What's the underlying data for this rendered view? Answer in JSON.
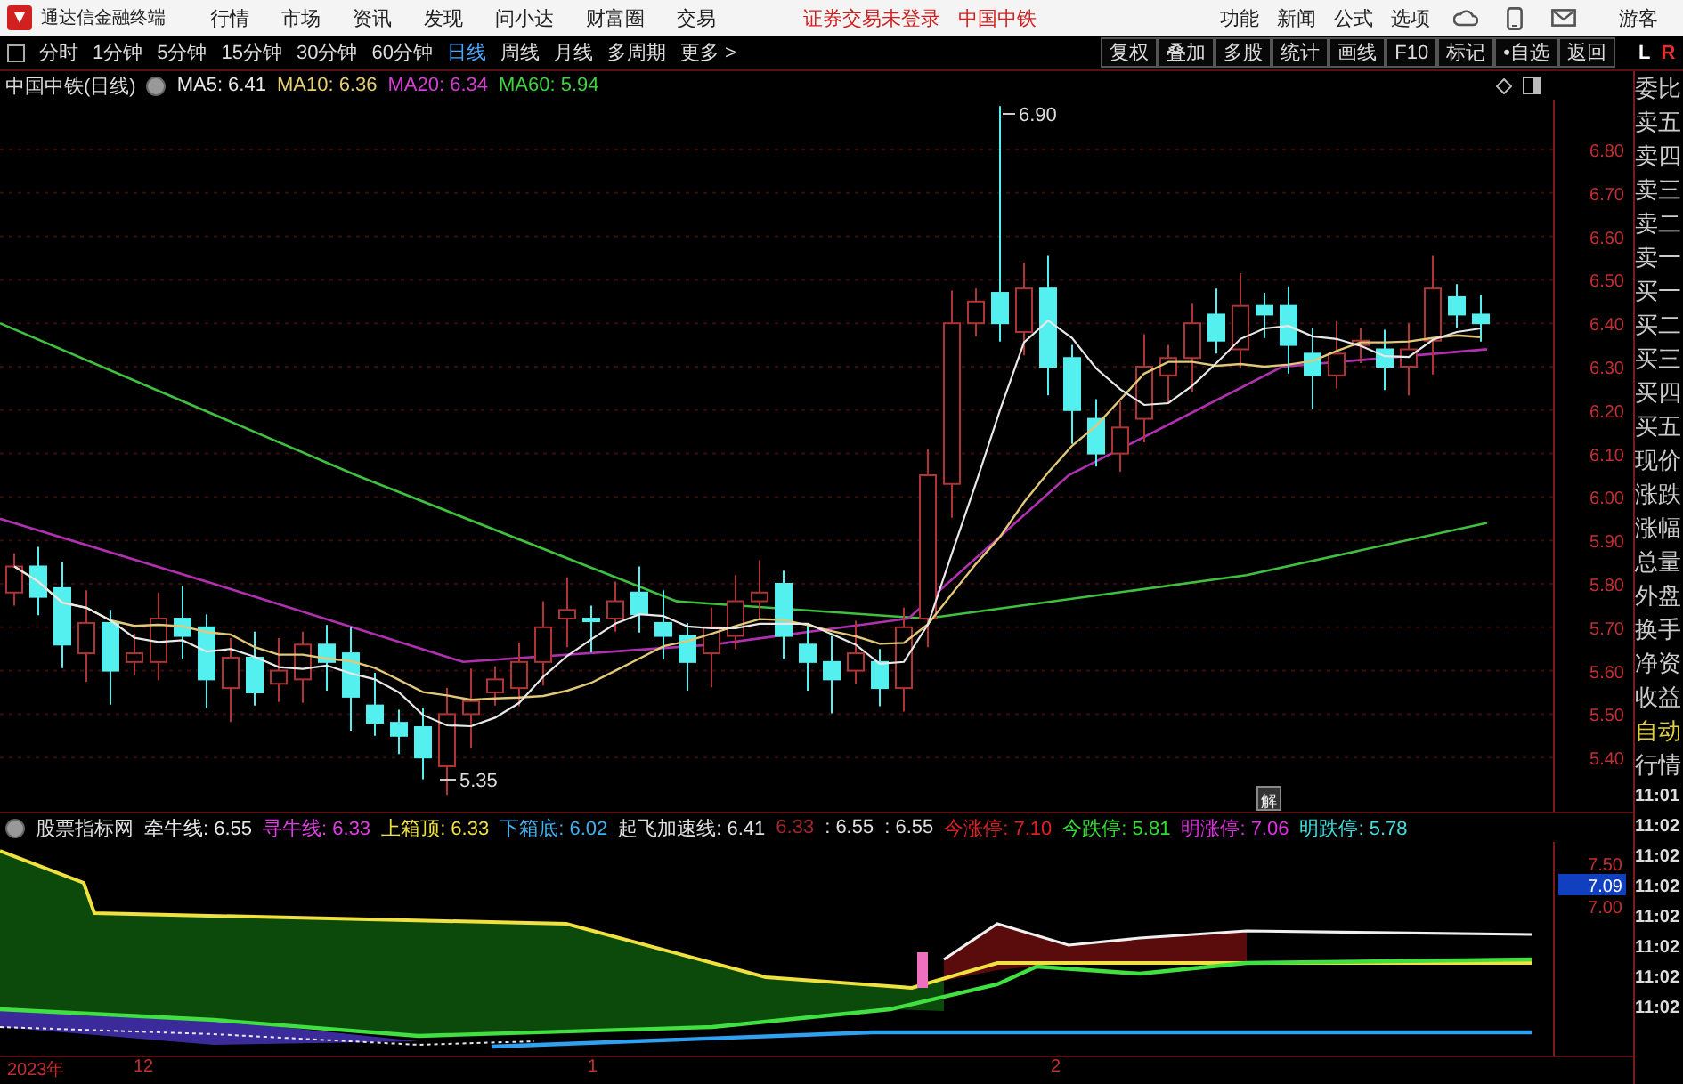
{
  "title_bar": {
    "app_name": "通达信金融终端",
    "menus": [
      "行情",
      "市场",
      "资讯",
      "发现",
      "问小达",
      "财富圈",
      "交易"
    ],
    "notices": [
      "证券交易未登录",
      "中国中铁"
    ],
    "tools": [
      "功能",
      "新闻",
      "公式",
      "选项"
    ],
    "user": "游客"
  },
  "period_tabs": [
    {
      "label": "分时",
      "selected": false
    },
    {
      "label": "1分钟",
      "selected": false
    },
    {
      "label": "5分钟",
      "selected": false
    },
    {
      "label": "15分钟",
      "selected": false
    },
    {
      "label": "30分钟",
      "selected": false
    },
    {
      "label": "60分钟",
      "selected": false
    },
    {
      "label": "日线",
      "selected": true
    },
    {
      "label": "周线",
      "selected": false
    },
    {
      "label": "月线",
      "selected": false
    },
    {
      "label": "多周期",
      "selected": false
    },
    {
      "label": "更多 >",
      "selected": false
    }
  ],
  "tool_buttons": [
    "复权",
    "叠加",
    "多股",
    "统计",
    "画线",
    "F10",
    "标记",
    "•自选",
    "返回"
  ],
  "panel_switch": [
    {
      "label": "L",
      "color": "#ffffff"
    },
    {
      "label": "R",
      "color": "#e03030"
    }
  ],
  "main_chart": {
    "title": "中国中铁(日线)",
    "ma_legend": [
      {
        "label": "MA5:",
        "value": "6.41",
        "color": "#e8e8e8"
      },
      {
        "label": "MA10:",
        "value": "6.36",
        "color": "#e8d070"
      },
      {
        "label": "MA20:",
        "value": "6.34",
        "color": "#d040d0"
      },
      {
        "label": "MA60:",
        "value": "5.94",
        "color": "#40d040"
      }
    ],
    "price_axis": [
      "6.80",
      "6.70",
      "6.60",
      "6.50",
      "6.40",
      "6.30",
      "6.20",
      "6.10",
      "6.00",
      "5.90",
      "5.80",
      "5.70",
      "5.60",
      "5.50",
      "5.40"
    ],
    "high_label": "6.90",
    "low_label": "5.35",
    "marker": "解"
  },
  "indicator": {
    "legend_title": "股票指标网",
    "legend": [
      {
        "label": "牵牛线:",
        "value": "6.55",
        "color": "#e8e8e8"
      },
      {
        "label": "寻牛线:",
        "value": "6.33",
        "color": "#e040e0"
      },
      {
        "label": "上箱顶:",
        "value": "6.33",
        "color": "#f0e040"
      },
      {
        "label": "下箱底:",
        "value": "6.02",
        "color": "#40b0f0"
      },
      {
        "label": "起飞加速线:",
        "value": "6.41",
        "color": "#e0e0e0"
      },
      {
        "value": "6.33",
        "color": "#a02828"
      },
      {
        "value": ": 6.55",
        "color": "#e0e0e0"
      },
      {
        "value": ": 6.55",
        "color": "#e0e0e0"
      },
      {
        "label": "今涨停:",
        "value": "7.10",
        "color": "#e02020"
      },
      {
        "label": "今跌停:",
        "value": "5.81",
        "color": "#30e030"
      },
      {
        "label": "明涨停:",
        "value": "7.06",
        "color": "#e030e0"
      },
      {
        "label": "明跌停:",
        "value": "5.78",
        "color": "#40e0e0"
      }
    ],
    "axis": [
      {
        "text": "7.50",
        "kind": "tick"
      },
      {
        "text": "7.09",
        "kind": "current"
      },
      {
        "text": "7.00",
        "kind": "tick"
      }
    ]
  },
  "date_axis": [
    "2023年",
    "12",
    "1",
    "2"
  ],
  "quote_panel": {
    "labels": [
      {
        "text": "委比",
        "kind": "label"
      },
      {
        "text": "卖五",
        "kind": "label"
      },
      {
        "text": "卖四",
        "kind": "label"
      },
      {
        "text": "卖三",
        "kind": "label"
      },
      {
        "text": "卖二",
        "kind": "label"
      },
      {
        "text": "卖一",
        "kind": "label"
      },
      {
        "text": "买一",
        "kind": "label"
      },
      {
        "text": "买二",
        "kind": "label"
      },
      {
        "text": "买三",
        "kind": "label"
      },
      {
        "text": "买四",
        "kind": "label"
      },
      {
        "text": "买五",
        "kind": "label"
      },
      {
        "text": "现价",
        "kind": "label"
      },
      {
        "text": "涨跌",
        "kind": "label"
      },
      {
        "text": "涨幅",
        "kind": "label"
      },
      {
        "text": "总量",
        "kind": "label"
      },
      {
        "text": "外盘",
        "kind": "label"
      },
      {
        "text": "换手",
        "kind": "label"
      },
      {
        "text": "净资",
        "kind": "label"
      },
      {
        "text": "收益",
        "kind": "label"
      },
      {
        "text": "自动",
        "kind": "toggle"
      },
      {
        "text": "行情",
        "kind": "label"
      }
    ],
    "times": [
      "11:01",
      "11:02",
      "11:02",
      "11:02",
      "11:02",
      "11:02",
      "11:02",
      "11:02"
    ]
  }
}
